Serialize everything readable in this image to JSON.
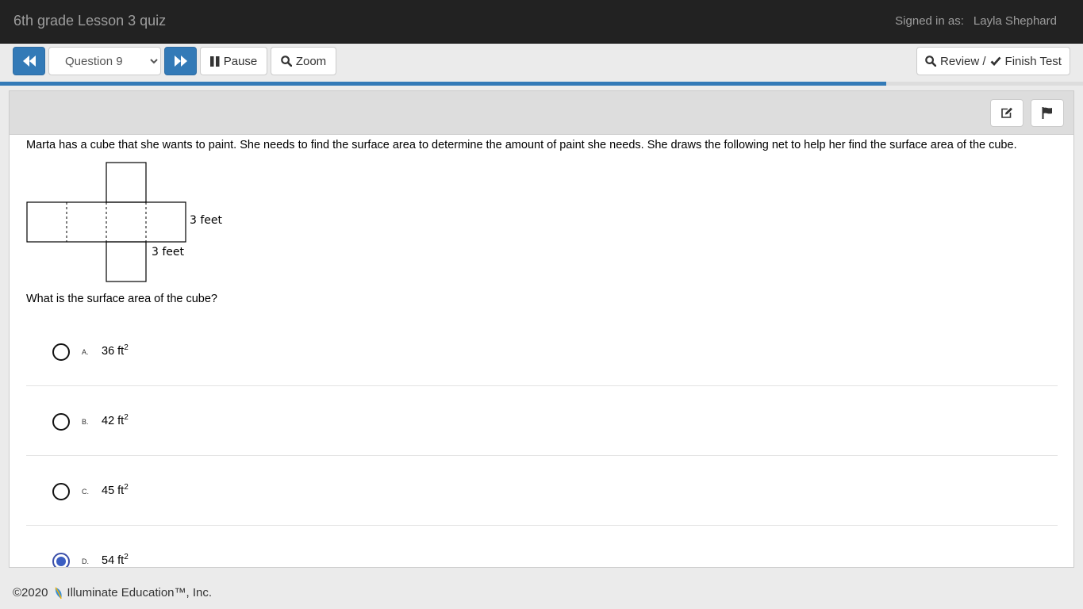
{
  "header": {
    "title": "6th grade Lesson 3 quiz",
    "signed_in_label": "Signed in as:",
    "user_name": "Layla Shephard"
  },
  "toolbar": {
    "question_select": {
      "selected": "Question 9",
      "options": [
        "Question 9"
      ]
    },
    "pause_label": "Pause",
    "zoom_label": "Zoom",
    "review_label": "Review /",
    "finish_label": "Finish Test"
  },
  "progress": {
    "fraction": 0.818
  },
  "question": {
    "prompt": "Marta has a cube that she wants to paint. She needs to find the surface area to determine the amount of paint she needs. She draws the following net to help her find the surface area of the cube.",
    "net_labels": {
      "side": "3 feet",
      "bottom": "3 feet"
    },
    "text": "What is the surface area of the cube?",
    "choices": [
      {
        "letter": "A.",
        "value": "36 ft",
        "exponent": "2",
        "selected": false
      },
      {
        "letter": "B.",
        "value": "42 ft",
        "exponent": "2",
        "selected": false
      },
      {
        "letter": "C.",
        "value": "45 ft",
        "exponent": "2",
        "selected": false
      },
      {
        "letter": "D.",
        "value": "54 ft",
        "exponent": "2",
        "selected": true
      }
    ]
  },
  "footer": {
    "copyright": "©2020",
    "company": "Illuminate Education™, Inc."
  },
  "colors": {
    "primary": "#337ab7",
    "topbar": "#222222",
    "selected_radio": "#3b5ec2"
  },
  "icons": [
    "fast-backward-icon",
    "fast-forward-icon",
    "pause-icon",
    "search-icon",
    "check-icon",
    "edit-icon",
    "flag-icon",
    "leaf-logo-icon"
  ]
}
